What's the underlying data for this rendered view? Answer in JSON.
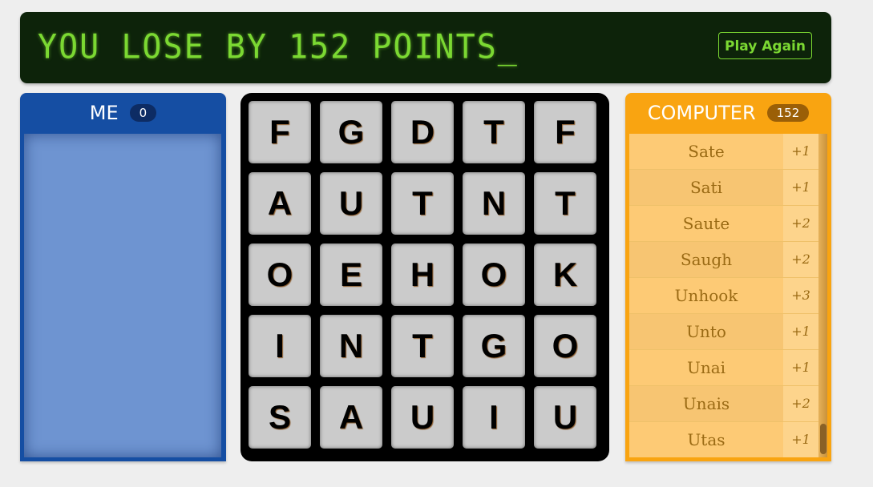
{
  "banner": {
    "message": "YOU LOSE BY 152 POINTS_",
    "play_again_label": "Play Again"
  },
  "player": {
    "name": "ME",
    "score": "0",
    "words": []
  },
  "computer": {
    "name": "COMPUTER",
    "score": "152",
    "words": [
      {
        "word": "Sate",
        "points": "+1"
      },
      {
        "word": "Sati",
        "points": "+1"
      },
      {
        "word": "Saute",
        "points": "+2"
      },
      {
        "word": "Saugh",
        "points": "+2"
      },
      {
        "word": "Unhook",
        "points": "+3"
      },
      {
        "word": "Unto",
        "points": "+1"
      },
      {
        "word": "Unai",
        "points": "+1"
      },
      {
        "word": "Unais",
        "points": "+2"
      },
      {
        "word": "Utas",
        "points": "+1"
      }
    ]
  },
  "board": {
    "rows": [
      [
        "F",
        "G",
        "D",
        "T",
        "F"
      ],
      [
        "A",
        "U",
        "T",
        "N",
        "T"
      ],
      [
        "O",
        "E",
        "H",
        "O",
        "K"
      ],
      [
        "I",
        "N",
        "T",
        "G",
        "O"
      ],
      [
        "S",
        "A",
        "U",
        "I",
        "U"
      ]
    ]
  },
  "colors": {
    "lcd_green": "#7bd832",
    "banner_bg": "#0d230a",
    "player_blue": "#154ea3",
    "computer_orange": "#f9a411",
    "tile_gray": "#cbcbcb"
  }
}
